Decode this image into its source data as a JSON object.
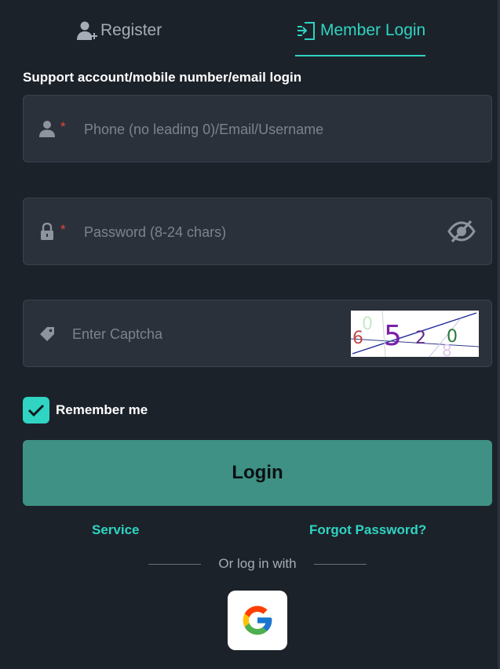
{
  "tabs": {
    "register_label": "Register",
    "login_label": "Member Login"
  },
  "subtitle": "Support account/mobile number/email login",
  "fields": {
    "username": {
      "placeholder": "Phone (no leading 0)/Email/Username",
      "value": "",
      "required_mark": "*",
      "icon": "user-icon"
    },
    "password": {
      "placeholder": "Password (8-24 chars)",
      "value": "",
      "required_mark": "*",
      "icon": "lock-icon",
      "toggle_icon": "eye-off-icon"
    },
    "captcha": {
      "placeholder": "Enter Captcha",
      "value": "",
      "icon": "tag-icon",
      "image_chars": [
        "6",
        "0",
        "5",
        "2",
        "0",
        "8"
      ]
    }
  },
  "remember": {
    "label": "Remember me",
    "checked": true
  },
  "login_button": "Login",
  "links": {
    "service": "Service",
    "forgot": "Forgot Password?"
  },
  "divider_text": "Or log in with",
  "social": {
    "google_icon": "google-icon"
  },
  "colors": {
    "background": "#1c222a",
    "accent": "#2fd4c2",
    "button": "#3e9184",
    "field_bg": "#2b313b",
    "required": "#e2463d"
  }
}
